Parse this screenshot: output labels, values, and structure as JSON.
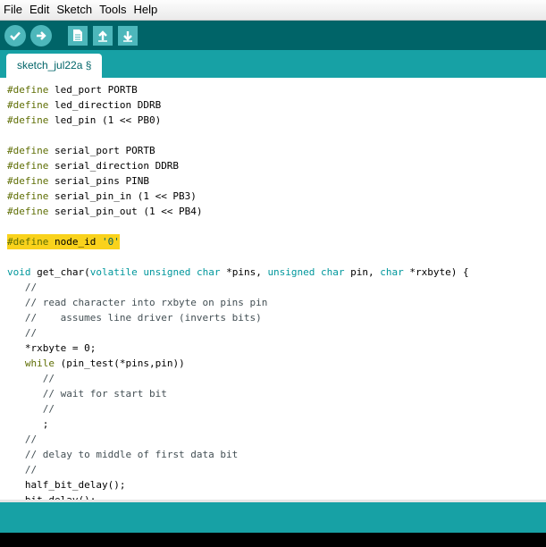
{
  "colors": {
    "toolbar_bg": "#006468",
    "tabbar_bg": "#17a1a5",
    "button_bg": "#4db7bb",
    "highlight": "#f9d21c",
    "keyword": "#5e6d03",
    "type": "#00979c"
  },
  "menu": [
    "File",
    "Edit",
    "Sketch",
    "Tools",
    "Help"
  ],
  "toolbar": {
    "buttons": [
      {
        "name": "verify",
        "icon": "check-icon"
      },
      {
        "name": "upload",
        "icon": "arrow-right-icon"
      },
      {
        "name": "new",
        "icon": "document-icon"
      },
      {
        "name": "open",
        "icon": "arrow-up-icon"
      },
      {
        "name": "save",
        "icon": "arrow-down-icon"
      }
    ]
  },
  "tab": {
    "label": "sketch_jul22a §"
  },
  "code": [
    "#define led_port PORTB",
    "#define led_direction DDRB",
    "#define led_pin (1 << PB0)",
    "",
    "#define serial_port PORTB",
    "#define serial_direction DDRB",
    "#define serial_pins PINB",
    "#define serial_pin_in (1 << PB3)",
    "#define serial_pin_out (1 << PB4)",
    "",
    "#define node_id '0'",
    "",
    "void get_char(volatile unsigned char *pins, unsigned char pin, char *rxbyte) {",
    "   //",
    "   // read character into rxbyte on pins pin",
    "   //    assumes line driver (inverts bits)",
    "   //",
    "   *rxbyte = 0;",
    "   while (pin_test(*pins,pin))",
    "      //",
    "      // wait for start bit",
    "      //",
    "      ;",
    "   //",
    "   // delay to middle of first data bit",
    "   //",
    "   half_bit_delay();",
    "   bit_delay();"
  ],
  "highlighted_line_index": 10
}
